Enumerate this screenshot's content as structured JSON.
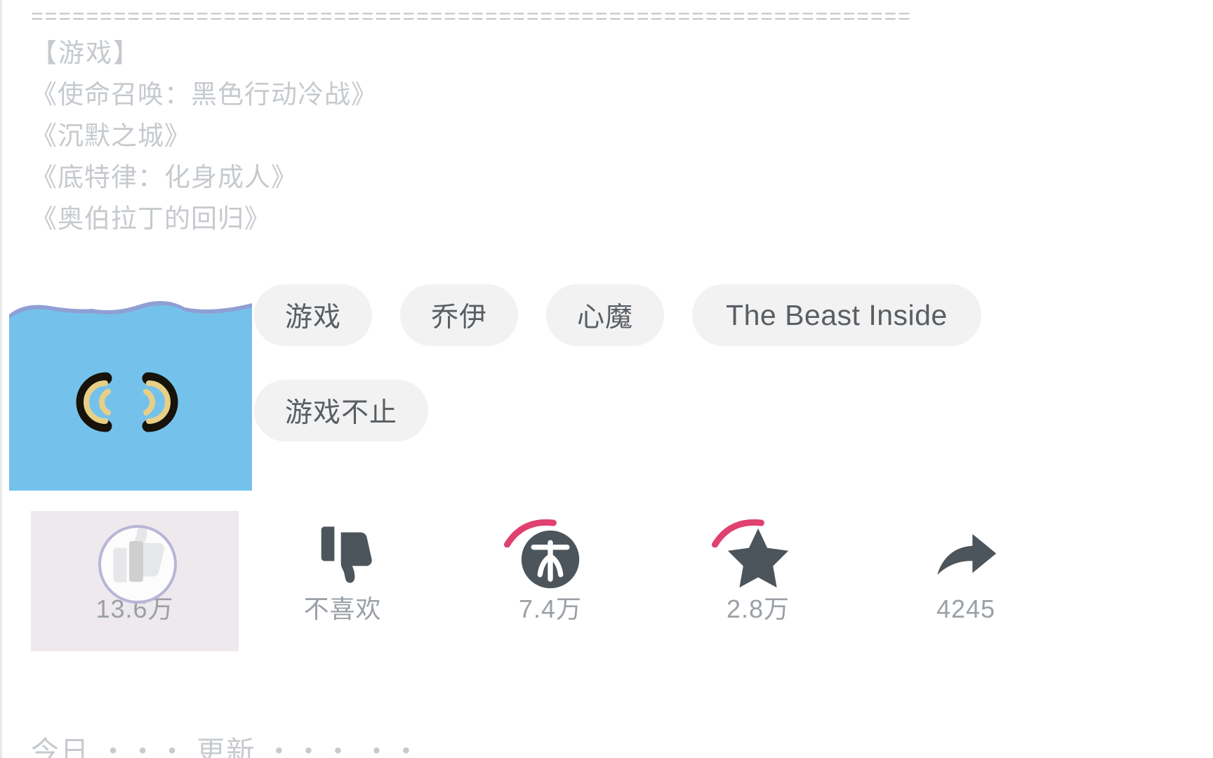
{
  "description": {
    "divider": "==================================",
    "lines": [
      "【游戏】",
      "《使命召唤：黑色行动冷战》",
      "《沉默之城》",
      "《底特律：化身成人》",
      "《奥伯拉丁的回归》"
    ]
  },
  "tags": [
    {
      "label": "游戏",
      "latin": false
    },
    {
      "label": "乔伊",
      "latin": false
    },
    {
      "label": "心魔",
      "latin": false
    },
    {
      "label": "The Beast Inside",
      "latin": true
    },
    {
      "label": "游戏不止",
      "latin": false
    }
  ],
  "thumbnail": {
    "alt": "water-thumbnail",
    "water_color": "#74c2ec",
    "wave_shadow_color": "#8f9fd4",
    "icon": "sound-wave-pair"
  },
  "actions": [
    {
      "name": "like",
      "icon": "thumbs-up-icon",
      "label": "13.6万",
      "active": true,
      "arc": false,
      "loading": true
    },
    {
      "name": "dislike",
      "icon": "thumbs-down-icon",
      "label": "不喜欢",
      "active": false,
      "arc": false,
      "loading": false
    },
    {
      "name": "coin",
      "icon": "coin-bu-icon",
      "label": "7.4万",
      "active": false,
      "arc": true,
      "loading": false
    },
    {
      "name": "favorite",
      "icon": "star-icon",
      "label": "2.8万",
      "active": false,
      "arc": true,
      "loading": false
    },
    {
      "name": "share",
      "icon": "share-arrow-icon",
      "label": "4245",
      "active": false,
      "arc": false,
      "loading": false
    }
  ],
  "colors": {
    "text_muted": "#c6cace",
    "chip_bg": "#f2f2f2",
    "chip_text": "#585e63",
    "icon_dark": "#4c555c",
    "accent_pink": "#e0416f",
    "highlight_bg": "#eee9ed"
  },
  "bottom_partial": "今日 ・・・ 更新 ・・・ ・・"
}
